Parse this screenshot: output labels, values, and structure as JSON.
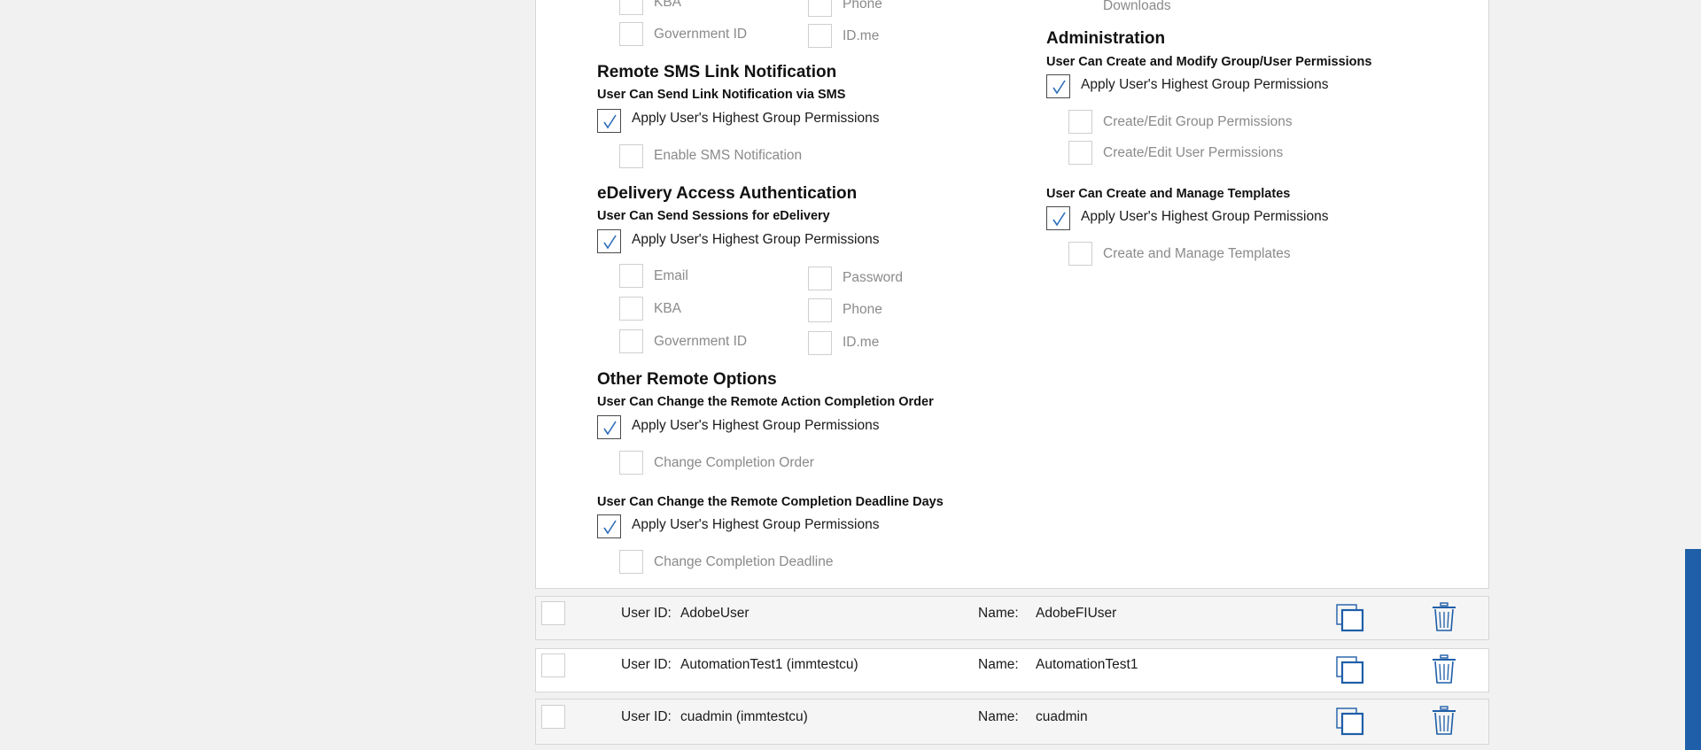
{
  "left_col": {
    "top_partial": {
      "row1_left": "KBA",
      "row1_right": "Phone",
      "row2_left": "Government ID",
      "row2_right": "ID.me"
    },
    "sms": {
      "title": "Remote SMS Link Notification",
      "subtitle": "User Can Send Link Notification via SMS",
      "apply_label": "Apply User's Highest Group Permissions",
      "apply_checked": true,
      "option": "Enable SMS Notification"
    },
    "edelivery": {
      "title": "eDelivery Access Authentication",
      "subtitle": "User Can Send Sessions for eDelivery",
      "apply_label": "Apply User's Highest Group Permissions",
      "apply_checked": true,
      "opt_email": "Email",
      "opt_password": "Password",
      "opt_kba": "KBA",
      "opt_phone": "Phone",
      "opt_govid": "Government ID",
      "opt_idme": "ID.me"
    },
    "other": {
      "title": "Other Remote Options",
      "sub1": "User Can Change the Remote Action Completion Order",
      "apply1": "Apply User's Highest Group Permissions",
      "option1": "Change Completion Order",
      "sub2": "User Can Change the Remote Completion Deadline Days",
      "apply2": "Apply User's Highest Group Permissions",
      "option2": "Change Completion Deadline"
    }
  },
  "right_col": {
    "downloads": "Downloads",
    "admin": {
      "title": "Administration",
      "sub1": "User Can Create and Modify Group/User Permissions",
      "apply1": "Apply User's Highest Group Permissions",
      "opt_group": "Create/Edit Group Permissions",
      "opt_user": "Create/Edit User Permissions",
      "sub2": "User Can Create and Manage Templates",
      "apply2": "Apply User's Highest Group Permissions",
      "opt_templates": "Create and Manage Templates"
    }
  },
  "users": [
    {
      "userid_label": "User ID:",
      "userid": "AdobeUser",
      "name_label": "Name:",
      "name": "AdobeFIUser"
    },
    {
      "userid_label": "User ID:",
      "userid": "AutomationTest1 (immtestcu)",
      "name_label": "Name:",
      "name": "AutomationTest1"
    },
    {
      "userid_label": "User ID:",
      "userid": "cuadmin (immtestcu)",
      "name_label": "Name:",
      "name": "cuadmin"
    }
  ],
  "colors": {
    "accent": "#1f5ea8",
    "check": "#2f6fba"
  },
  "icons": {
    "copy": "copy-icon",
    "delete": "trash-icon",
    "check": "checkmark-icon"
  }
}
